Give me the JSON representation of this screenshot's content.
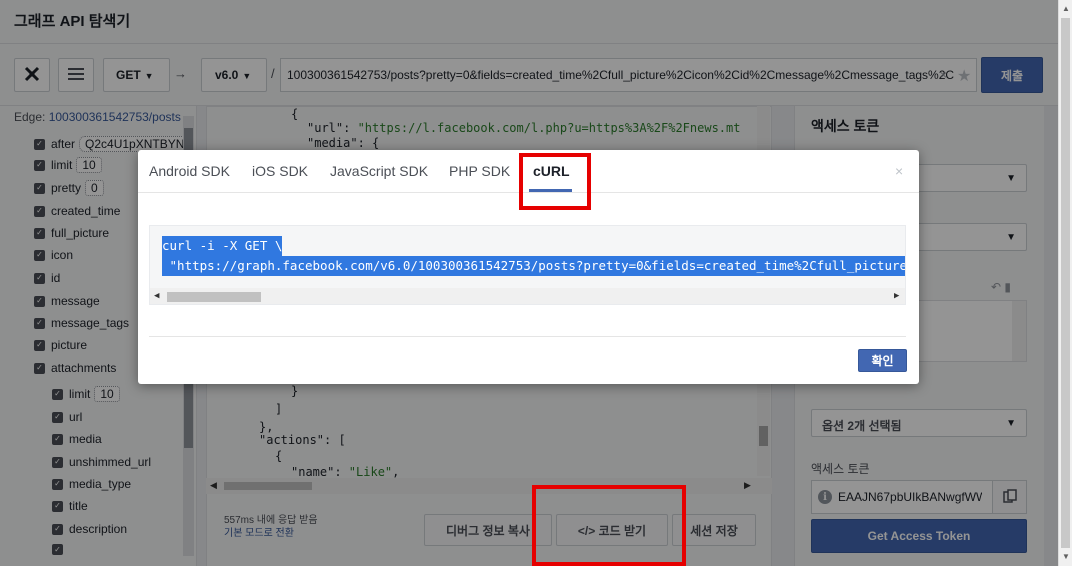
{
  "app": {
    "title": "그래프 API 탐색기"
  },
  "toolbar": {
    "method": "GET",
    "arrow": "→",
    "slash": "/",
    "version": "v6.0",
    "url": "100300361542753/posts?pretty=0&fields=created_time%2Cfull_picture%2Cicon%2Cid%2Cmessage%2Cmessage_tags%2C",
    "clear": "×",
    "submit_label": "제출"
  },
  "left_panel": {
    "edge_label": "Edge:",
    "edge_value": "100300361542753/posts",
    "fields": [
      {
        "name": "after",
        "value": "Q2c4U1pXNTBYN"
      },
      {
        "name": "limit",
        "value": "10"
      },
      {
        "name": "pretty",
        "value": "0"
      },
      {
        "name": "created_time"
      },
      {
        "name": "full_picture"
      },
      {
        "name": "icon"
      },
      {
        "name": "id"
      },
      {
        "name": "message"
      },
      {
        "name": "message_tags"
      },
      {
        "name": "picture"
      },
      {
        "name": "attachments"
      }
    ],
    "subfields": [
      {
        "name": "limit",
        "value": "10"
      },
      {
        "name": "url"
      },
      {
        "name": "media"
      },
      {
        "name": "unshimmed_url"
      },
      {
        "name": "media_type"
      },
      {
        "name": "title"
      },
      {
        "name": "description"
      }
    ]
  },
  "code": {
    "lines": [
      "{",
      "\"url\": ",
      "\"https://l.facebook.com/l.php?u=https%3A%2F%2Fnews.mt",
      "\"media\": {",
      "}",
      "]",
      "},",
      "\"actions\": [",
      "{",
      "\"name\": ",
      "\"Like\"",
      ","
    ]
  },
  "bottom": {
    "timing": "557ms 내에 응답 받음",
    "default_mode": "기본 모드로 전환",
    "debug_copy": "디버그 정보 복사",
    "get_code": "</> 코드 받기",
    "save_session": "세션 저장"
  },
  "right_panel": {
    "heading": "액세스 토큰",
    "options_selected": "옵션 2개 선택됨",
    "token_label": "액세스 토큰",
    "token_value": "EAAJN67pbUIkBANwgfWW",
    "get_token_label": "Get Access Token",
    "caret": "▼"
  },
  "modal": {
    "tabs": [
      "Android SDK",
      "iOS SDK",
      "JavaScript SDK",
      "PHP SDK",
      "cURL"
    ],
    "active_tab": "cURL",
    "close": "×",
    "code_line1": "curl -i -X GET \\",
    "code_line2": " \"https://graph.facebook.com/v6.0/100300361542753/posts?pretty=0&fields=created_time%2Cfull_picture",
    "confirm_label": "확인"
  },
  "colors": {
    "brand_blue": "#4267b2",
    "annotation_red": "#e60000",
    "selection_blue": "#3078e0"
  }
}
